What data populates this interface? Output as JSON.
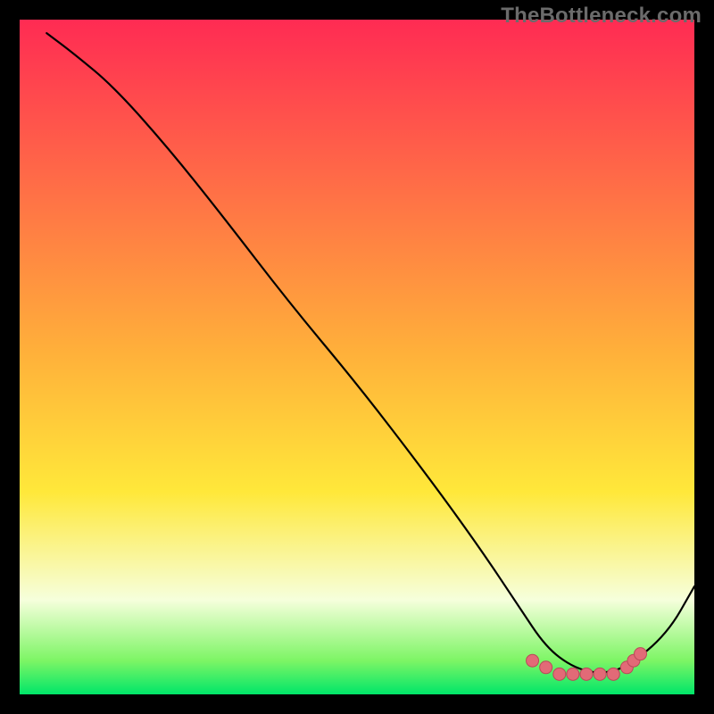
{
  "attribution": "TheBottleneck.com",
  "colors": {
    "top_red": "#ff2b53",
    "yellow": "#ffe83a",
    "pale": "#f6ffdc",
    "green": "#00e669",
    "curve": "#000000",
    "marker_fill": "#e26a77",
    "marker_stroke": "#b94a59"
  },
  "chart_data": {
    "type": "line",
    "title": "",
    "xlabel": "",
    "ylabel": "",
    "xlim": [
      0,
      100
    ],
    "ylim": [
      0,
      100
    ],
    "grid": false,
    "legend": false,
    "series": [
      {
        "name": "curve",
        "x": [
          4,
          8,
          14,
          22,
          30,
          40,
          50,
          60,
          68,
          74,
          78,
          82,
          86,
          90,
          96,
          100
        ],
        "y": [
          98,
          95,
          90,
          81,
          71,
          58,
          46,
          33,
          22,
          13,
          7,
          4,
          3,
          4,
          9,
          16
        ]
      }
    ],
    "markers": {
      "name": "highlighted-points",
      "x": [
        76,
        78,
        80,
        82,
        84,
        86,
        88,
        90,
        91,
        92
      ],
      "y": [
        5,
        4,
        3,
        3,
        3,
        3,
        3,
        4,
        5,
        6
      ]
    }
  }
}
